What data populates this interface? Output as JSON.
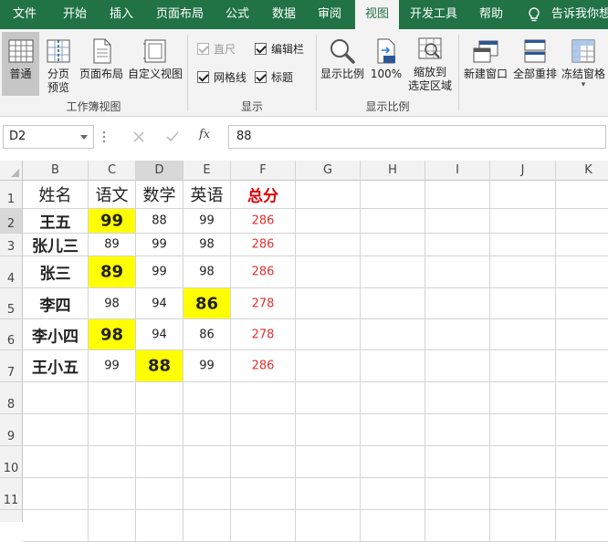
{
  "tabs": [
    {
      "label": "文件",
      "active": false
    },
    {
      "label": "开始",
      "active": false
    },
    {
      "label": "插入",
      "active": false
    },
    {
      "label": "页面布局",
      "active": false
    },
    {
      "label": "公式",
      "active": false
    },
    {
      "label": "数据",
      "active": false
    },
    {
      "label": "审阅",
      "active": false
    },
    {
      "label": "视图",
      "active": true
    },
    {
      "label": "开发工具",
      "active": false
    },
    {
      "label": "帮助",
      "active": false
    }
  ],
  "tell_me": "告诉我你想",
  "ribbon": {
    "workbook_views": {
      "label": "工作簿视图",
      "normal": "普通",
      "page_break_line1": "分页",
      "page_break_line2": "预览",
      "page_layout": "页面布局",
      "custom_views": "自定义视图"
    },
    "show": {
      "label": "显示",
      "ruler": "直尺",
      "formula_bar": "编辑栏",
      "gridlines": "网格线",
      "headings": "标题"
    },
    "zoom": {
      "label": "显示比例",
      "zoom": "显示比例",
      "hundred": "100%",
      "zoom_sel_line1": "缩放到",
      "zoom_sel_line2": "选定区域"
    },
    "window": {
      "new_window": "新建窗口",
      "arrange_all": "全部重排",
      "freeze_panes": "冻结窗格"
    }
  },
  "formula_bar": {
    "name_box": "D2",
    "fx": "fx",
    "value": "88"
  },
  "columns": [
    "B",
    "C",
    "D",
    "E",
    "F",
    "G",
    "H",
    "I",
    "J",
    "K"
  ],
  "rows": [
    "1",
    "2",
    "3",
    "4",
    "5",
    "6",
    "7",
    "8",
    "9",
    "10",
    "11"
  ],
  "table": {
    "headers": [
      "姓名",
      "语文",
      "数学",
      "英语",
      "总分"
    ],
    "records": [
      {
        "name": "王五",
        "chinese": "99",
        "math": "88",
        "english": "99",
        "total": "286"
      },
      {
        "name": "张儿三",
        "chinese": "89",
        "math": "99",
        "english": "98",
        "total": "286"
      },
      {
        "name": "张三",
        "chinese": "89",
        "math": "99",
        "english": "98",
        "total": "286"
      },
      {
        "name": "李四",
        "chinese": "98",
        "math": "94",
        "english": "86",
        "total": "278"
      },
      {
        "name": "李小四",
        "chinese": "98",
        "math": "94",
        "english": "86",
        "total": "278"
      },
      {
        "name": "王小五",
        "chinese": "99",
        "math": "88",
        "english": "99",
        "total": "286"
      }
    ]
  },
  "colors": {
    "accent": "#217346",
    "highlight": "#ffff00",
    "total_text": "#e00000"
  }
}
